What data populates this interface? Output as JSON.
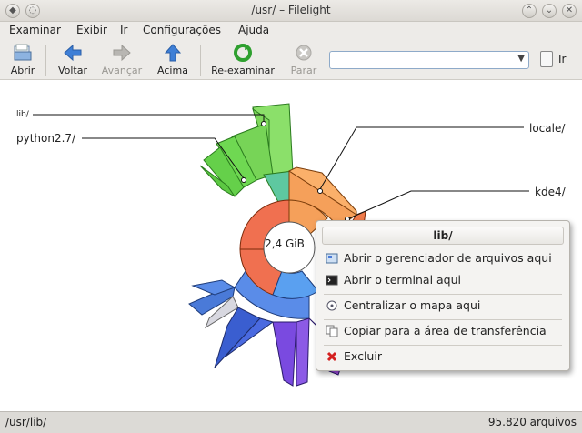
{
  "window": {
    "title": "/usr/ – Filelight",
    "minimize_glyph": "⌃",
    "maximize_glyph": "⌄",
    "close_glyph": "✕"
  },
  "menu": [
    {
      "label": "Examinar"
    },
    {
      "label": "Exibir"
    },
    {
      "label": "Ir"
    },
    {
      "label": "Configurações"
    },
    {
      "label": "Ajuda"
    }
  ],
  "toolbar": {
    "open": "Abrir",
    "back": "Voltar",
    "forward": "Avançar",
    "up": "Acima",
    "rescan": "Re-examinar",
    "stop": "Parar",
    "go": "Ir",
    "location_value": ""
  },
  "map": {
    "center_size": "2,4 GiB",
    "labels": {
      "lib": "lib/",
      "python": "python2.7/",
      "locale": "locale/",
      "kde4": "kde4/"
    },
    "colors": {
      "orange": "#f5a05a",
      "green": "#6fd85a",
      "blue": "#5a8ce8",
      "purple": "#8c5ae6"
    }
  },
  "context_menu": {
    "title": "lib/",
    "items": [
      {
        "label": "Abrir o gerenciador de arquivos aqui",
        "icon": "file-manager-icon"
      },
      {
        "label": "Abrir o terminal aqui",
        "icon": "terminal-icon"
      },
      {
        "label": "Centralizar o mapa aqui",
        "icon": "center-map-icon"
      },
      {
        "label": "Copiar para a área de transferência",
        "icon": "copy-icon"
      },
      {
        "label": "Excluir",
        "icon": "delete-icon"
      }
    ]
  },
  "status": {
    "path": "/usr/lib/",
    "files": "95.820 arquivos"
  }
}
